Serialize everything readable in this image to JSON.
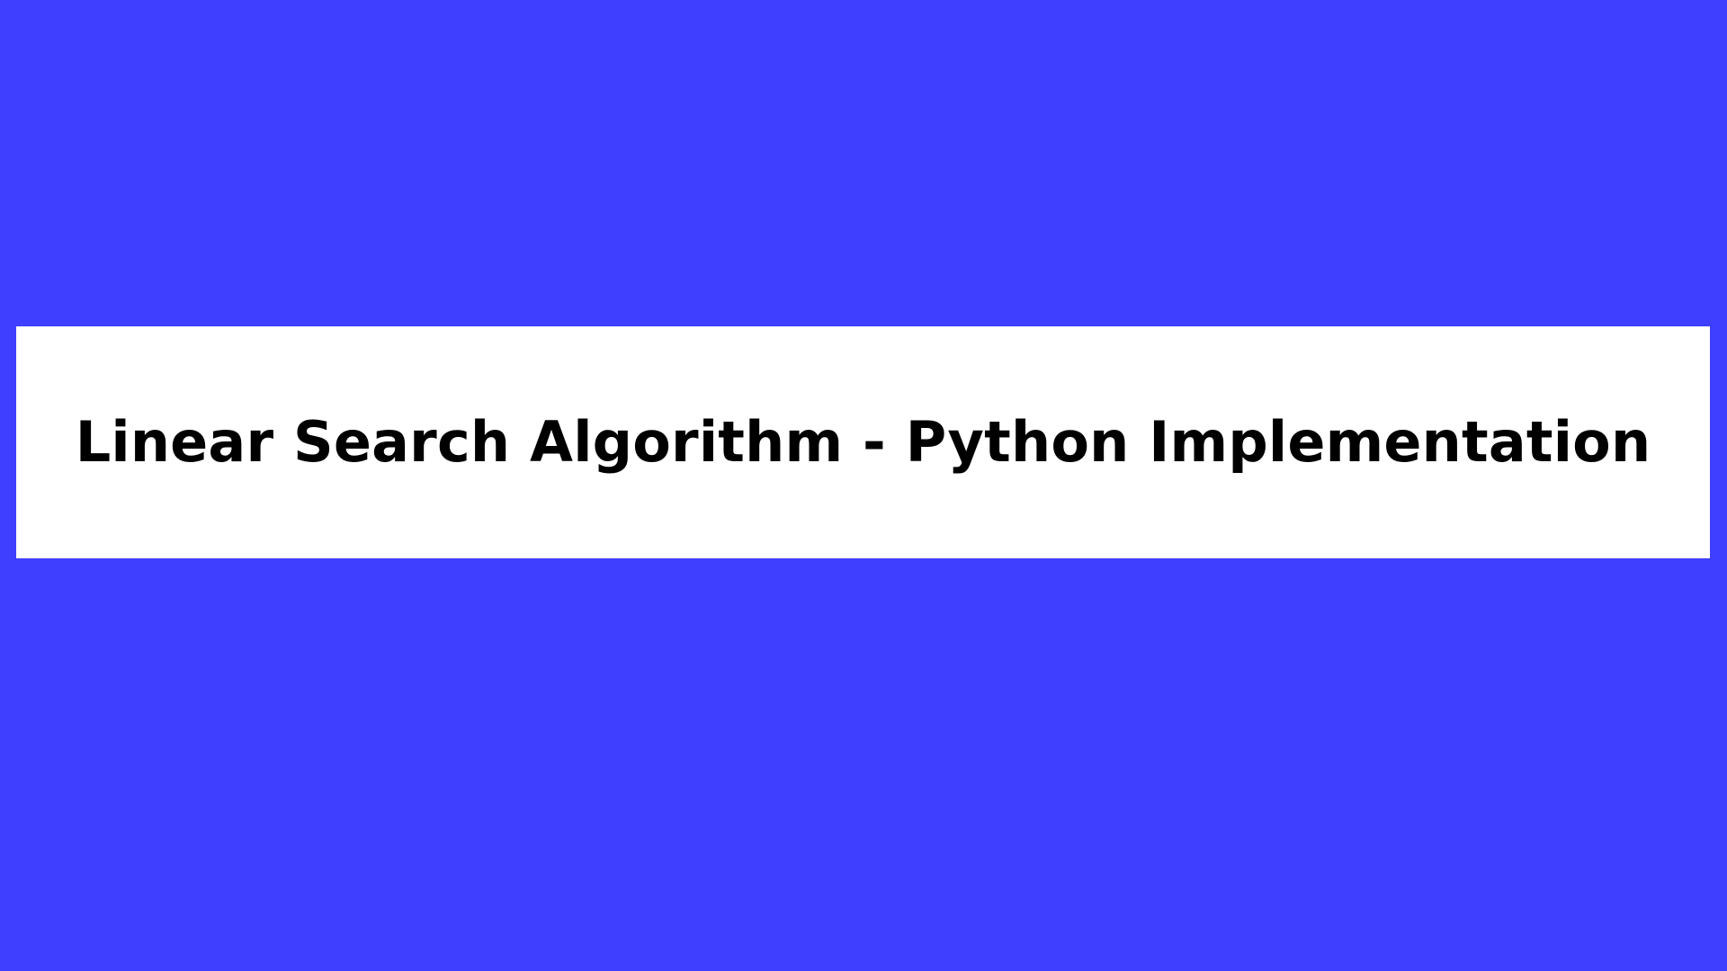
{
  "page": {
    "title": "Linear Search Algorithm - Python Implementation"
  },
  "colors": {
    "background": "#3f3fff",
    "card": "#ffffff",
    "text": "#000000"
  }
}
